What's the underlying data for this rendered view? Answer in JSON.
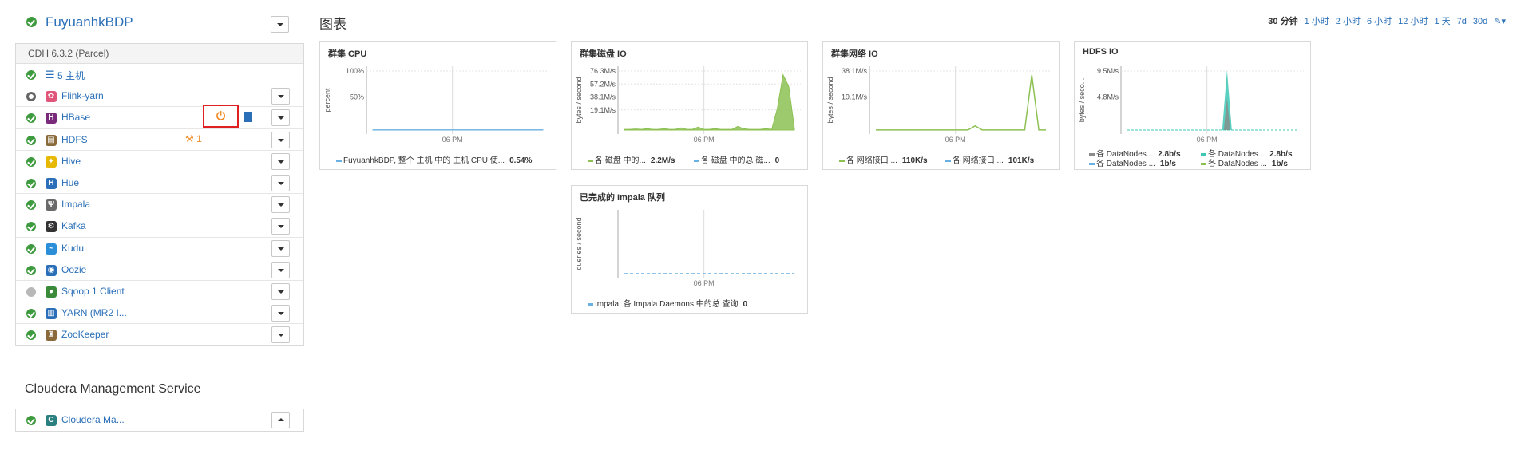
{
  "cluster": {
    "name": "FuyuanhkBDP",
    "version": "CDH 6.3.2 (Parcel)",
    "hosts_link": "5 主机",
    "services": [
      {
        "name": "Flink-yarn",
        "status": "ring",
        "icon": "flink-icon",
        "color": "#e0557a"
      },
      {
        "name": "HBase",
        "status": "ok",
        "icon": "hbase-icon",
        "color": "#7a2a7a"
      },
      {
        "name": "HDFS",
        "status": "ok",
        "icon": "hdfs-icon",
        "color": "#8a6a3a",
        "issues": "1"
      },
      {
        "name": "Hive",
        "status": "ok",
        "icon": "hive-icon",
        "color": "#e6b800"
      },
      {
        "name": "Hue",
        "status": "ok",
        "icon": "hue-icon",
        "color": "#2a6fb8"
      },
      {
        "name": "Impala",
        "status": "ok",
        "icon": "impala-icon",
        "color": "#6a6a6a"
      },
      {
        "name": "Kafka",
        "status": "ok",
        "icon": "kafka-icon",
        "color": "#333333"
      },
      {
        "name": "Kudu",
        "status": "ok",
        "icon": "kudu-icon",
        "color": "#2a8fd8"
      },
      {
        "name": "Oozie",
        "status": "ok",
        "icon": "oozie-icon",
        "color": "#2a6fb8"
      },
      {
        "name": "Sqoop 1 Client",
        "status": "gray",
        "icon": "sqoop-icon",
        "color": "#3a8a3a"
      },
      {
        "name": "YARN (MR2 I...",
        "status": "ok",
        "icon": "yarn-icon",
        "color": "#2a6fb8"
      },
      {
        "name": "ZooKeeper",
        "status": "ok",
        "icon": "zookeeper-icon",
        "color": "#8a6a3a"
      }
    ]
  },
  "management": {
    "title": "Cloudera Management Service",
    "service_name": "Cloudera Ma...",
    "icon_color": "#2a8080"
  },
  "charts_title": "图表",
  "time_range": {
    "options": [
      "30 分钟",
      "1 小时",
      "2 小时",
      "6 小时",
      "12 小时",
      "1 天",
      "7d",
      "30d"
    ],
    "active": "30 分钟"
  },
  "colors": {
    "ok": "#3e9a3e",
    "link": "#2a6fb8",
    "cpu": "#6ab0e0",
    "green": "#8cc152",
    "teal": "#3cc8b4",
    "gray": "#8a8a8a"
  },
  "chart_data": [
    {
      "type": "area",
      "title": "群集 CPU",
      "ylabel": "percent",
      "y_ticks": [
        "100%",
        "50%"
      ],
      "x_ticks": [
        "06 PM"
      ],
      "series": [
        {
          "name": "FuyuanhkBDP, 整个 主机 中的 主机 CPU 使...",
          "value": "0.54%",
          "values": [
            0.5,
            0.5,
            0.6,
            0.5,
            0.5,
            0.6,
            0.5,
            0.5,
            0.5,
            0.6,
            0.5,
            0.5
          ]
        }
      ],
      "ylim": [
        0,
        100
      ]
    },
    {
      "type": "area",
      "title": "群集磁盘 IO",
      "ylabel": "bytes / second",
      "y_ticks": [
        "76.3M/s",
        "57.2M/s",
        "38.1M/s",
        "19.1M/s"
      ],
      "x_ticks": [
        "06 PM"
      ],
      "series": [
        {
          "name": "各 磁盘 中的...",
          "value": "2.2M/s",
          "values": [
            1,
            1,
            1.5,
            1,
            2,
            1,
            1,
            2,
            1,
            1,
            3,
            1,
            1,
            4,
            1,
            1,
            2,
            1,
            1,
            1,
            5,
            2,
            1,
            1,
            1,
            2,
            1,
            30,
            76,
            60,
            2
          ]
        },
        {
          "name": "各 磁盘 中的总 磁...",
          "value": "0",
          "values": []
        }
      ],
      "ylim": [
        0,
        80
      ]
    },
    {
      "type": "line",
      "title": "群集网络 IO",
      "ylabel": "bytes / second",
      "y_ticks": [
        "38.1M/s",
        "19.1M/s"
      ],
      "x_ticks": [
        "06 PM"
      ],
      "series": [
        {
          "name": "各 网络接口 ...",
          "value": "110K/s",
          "values": [
            0.1,
            0.1,
            0.1,
            0.1,
            0.1,
            0.1,
            0.1,
            0.1,
            0.1,
            0.1,
            0.1,
            0.1,
            0.1,
            0.1,
            4,
            0.1,
            0.1,
            0.1,
            0.1,
            0.1,
            0.1,
            0.1,
            52,
            0.1,
            0.1
          ]
        },
        {
          "name": "各 网络接口 ...",
          "value": "101K/s",
          "values": []
        }
      ],
      "ylim": [
        0,
        55
      ]
    },
    {
      "type": "area",
      "title": "HDFS IO",
      "ylabel": "bytes / seco...",
      "y_ticks": [
        "9.5M/s",
        "4.8M/s"
      ],
      "x_ticks": [
        "06 PM"
      ],
      "series": [
        {
          "name": "各 DataNodes...",
          "value": "2.8b/s"
        },
        {
          "name": "各 DataNodes...",
          "value": "2.8b/s"
        },
        {
          "name": "各 DataNodes ...",
          "value": "1b/s"
        },
        {
          "name": "各 DataNodes ...",
          "value": "1b/s"
        }
      ],
      "ylim": [
        0,
        11
      ]
    },
    {
      "type": "line",
      "title": "已完成的 Impala 队列",
      "ylabel": "queries / second",
      "y_ticks": [],
      "x_ticks": [
        "06 PM"
      ],
      "series": [
        {
          "name": "Impala, 各 Impala Daemons 中的总 查询",
          "value": "0",
          "values": [
            0,
            0,
            0,
            0,
            0,
            0,
            0,
            0
          ]
        }
      ],
      "ylim": [
        0,
        1
      ]
    }
  ]
}
